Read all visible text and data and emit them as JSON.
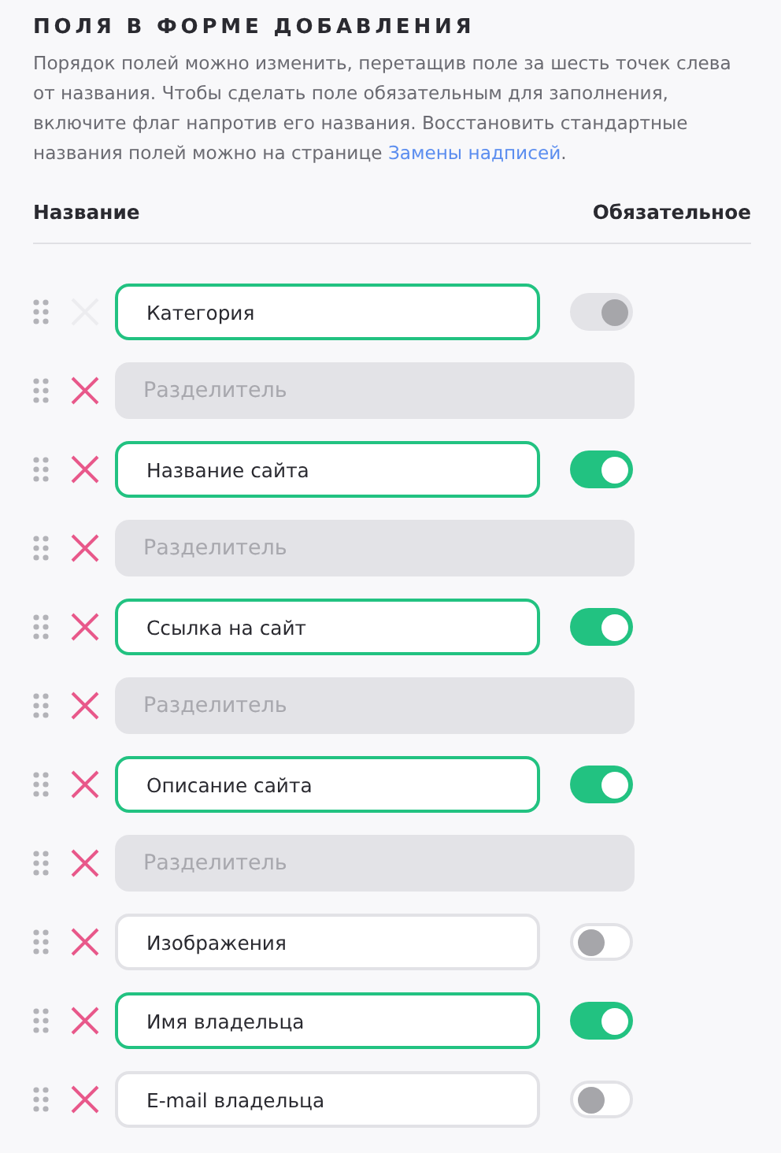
{
  "section": {
    "title": "ПОЛЯ В ФОРМЕ ДОБАВЛЕНИЯ",
    "description": "Порядок полей можно изменить, перетащив поле за шесть точек слева от названия. Чтобы сделать поле обязательным для заполнения, включите флаг напротив его названия. Восстановить стандартные названия полей можно на странице ",
    "link": "Замены надписей",
    "description_end": "."
  },
  "columns": {
    "name": "Название",
    "required": "Обязательное"
  },
  "rows": [
    {
      "kind": "field",
      "value": "Категория",
      "required": true,
      "locked": true
    },
    {
      "kind": "separator",
      "placeholder": "Разделитель"
    },
    {
      "kind": "field",
      "value": "Название сайта",
      "required": true,
      "locked": false
    },
    {
      "kind": "separator",
      "placeholder": "Разделитель"
    },
    {
      "kind": "field",
      "value": "Ссылка на сайт",
      "required": true,
      "locked": false
    },
    {
      "kind": "separator",
      "placeholder": "Разделитель"
    },
    {
      "kind": "field",
      "value": "Описание сайта",
      "required": true,
      "locked": false
    },
    {
      "kind": "separator",
      "placeholder": "Разделитель"
    },
    {
      "kind": "field",
      "value": "Изображения",
      "required": false,
      "locked": false
    },
    {
      "kind": "field",
      "value": "Имя владельца",
      "required": true,
      "locked": false
    },
    {
      "kind": "field",
      "value": "E-mail владельца",
      "required": false,
      "locked": false
    }
  ]
}
